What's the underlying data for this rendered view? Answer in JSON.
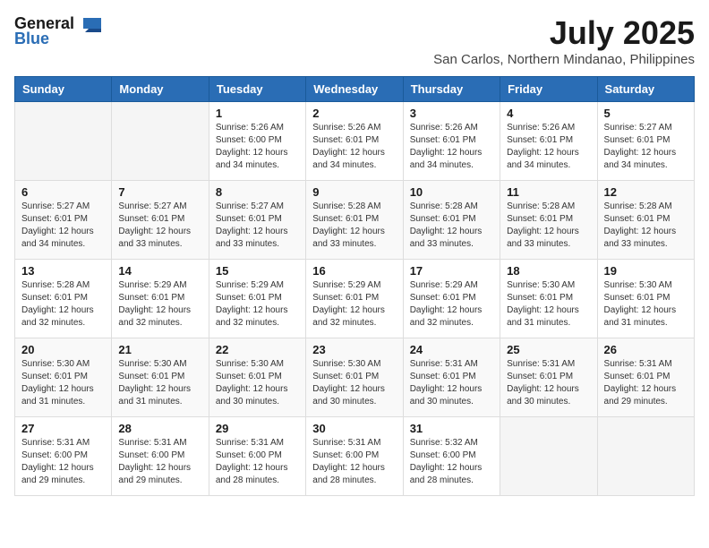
{
  "logo": {
    "general": "General",
    "blue": "Blue"
  },
  "title": {
    "month": "July 2025",
    "location": "San Carlos, Northern Mindanao, Philippines"
  },
  "weekdays": [
    "Sunday",
    "Monday",
    "Tuesday",
    "Wednesday",
    "Thursday",
    "Friday",
    "Saturday"
  ],
  "weeks": [
    [
      {
        "day": "",
        "info": ""
      },
      {
        "day": "",
        "info": ""
      },
      {
        "day": "1",
        "info": "Sunrise: 5:26 AM\nSunset: 6:00 PM\nDaylight: 12 hours and 34 minutes."
      },
      {
        "day": "2",
        "info": "Sunrise: 5:26 AM\nSunset: 6:01 PM\nDaylight: 12 hours and 34 minutes."
      },
      {
        "day": "3",
        "info": "Sunrise: 5:26 AM\nSunset: 6:01 PM\nDaylight: 12 hours and 34 minutes."
      },
      {
        "day": "4",
        "info": "Sunrise: 5:26 AM\nSunset: 6:01 PM\nDaylight: 12 hours and 34 minutes."
      },
      {
        "day": "5",
        "info": "Sunrise: 5:27 AM\nSunset: 6:01 PM\nDaylight: 12 hours and 34 minutes."
      }
    ],
    [
      {
        "day": "6",
        "info": "Sunrise: 5:27 AM\nSunset: 6:01 PM\nDaylight: 12 hours and 34 minutes."
      },
      {
        "day": "7",
        "info": "Sunrise: 5:27 AM\nSunset: 6:01 PM\nDaylight: 12 hours and 33 minutes."
      },
      {
        "day": "8",
        "info": "Sunrise: 5:27 AM\nSunset: 6:01 PM\nDaylight: 12 hours and 33 minutes."
      },
      {
        "day": "9",
        "info": "Sunrise: 5:28 AM\nSunset: 6:01 PM\nDaylight: 12 hours and 33 minutes."
      },
      {
        "day": "10",
        "info": "Sunrise: 5:28 AM\nSunset: 6:01 PM\nDaylight: 12 hours and 33 minutes."
      },
      {
        "day": "11",
        "info": "Sunrise: 5:28 AM\nSunset: 6:01 PM\nDaylight: 12 hours and 33 minutes."
      },
      {
        "day": "12",
        "info": "Sunrise: 5:28 AM\nSunset: 6:01 PM\nDaylight: 12 hours and 33 minutes."
      }
    ],
    [
      {
        "day": "13",
        "info": "Sunrise: 5:28 AM\nSunset: 6:01 PM\nDaylight: 12 hours and 32 minutes."
      },
      {
        "day": "14",
        "info": "Sunrise: 5:29 AM\nSunset: 6:01 PM\nDaylight: 12 hours and 32 minutes."
      },
      {
        "day": "15",
        "info": "Sunrise: 5:29 AM\nSunset: 6:01 PM\nDaylight: 12 hours and 32 minutes."
      },
      {
        "day": "16",
        "info": "Sunrise: 5:29 AM\nSunset: 6:01 PM\nDaylight: 12 hours and 32 minutes."
      },
      {
        "day": "17",
        "info": "Sunrise: 5:29 AM\nSunset: 6:01 PM\nDaylight: 12 hours and 32 minutes."
      },
      {
        "day": "18",
        "info": "Sunrise: 5:30 AM\nSunset: 6:01 PM\nDaylight: 12 hours and 31 minutes."
      },
      {
        "day": "19",
        "info": "Sunrise: 5:30 AM\nSunset: 6:01 PM\nDaylight: 12 hours and 31 minutes."
      }
    ],
    [
      {
        "day": "20",
        "info": "Sunrise: 5:30 AM\nSunset: 6:01 PM\nDaylight: 12 hours and 31 minutes."
      },
      {
        "day": "21",
        "info": "Sunrise: 5:30 AM\nSunset: 6:01 PM\nDaylight: 12 hours and 31 minutes."
      },
      {
        "day": "22",
        "info": "Sunrise: 5:30 AM\nSunset: 6:01 PM\nDaylight: 12 hours and 30 minutes."
      },
      {
        "day": "23",
        "info": "Sunrise: 5:30 AM\nSunset: 6:01 PM\nDaylight: 12 hours and 30 minutes."
      },
      {
        "day": "24",
        "info": "Sunrise: 5:31 AM\nSunset: 6:01 PM\nDaylight: 12 hours and 30 minutes."
      },
      {
        "day": "25",
        "info": "Sunrise: 5:31 AM\nSunset: 6:01 PM\nDaylight: 12 hours and 30 minutes."
      },
      {
        "day": "26",
        "info": "Sunrise: 5:31 AM\nSunset: 6:01 PM\nDaylight: 12 hours and 29 minutes."
      }
    ],
    [
      {
        "day": "27",
        "info": "Sunrise: 5:31 AM\nSunset: 6:00 PM\nDaylight: 12 hours and 29 minutes."
      },
      {
        "day": "28",
        "info": "Sunrise: 5:31 AM\nSunset: 6:00 PM\nDaylight: 12 hours and 29 minutes."
      },
      {
        "day": "29",
        "info": "Sunrise: 5:31 AM\nSunset: 6:00 PM\nDaylight: 12 hours and 28 minutes."
      },
      {
        "day": "30",
        "info": "Sunrise: 5:31 AM\nSunset: 6:00 PM\nDaylight: 12 hours and 28 minutes."
      },
      {
        "day": "31",
        "info": "Sunrise: 5:32 AM\nSunset: 6:00 PM\nDaylight: 12 hours and 28 minutes."
      },
      {
        "day": "",
        "info": ""
      },
      {
        "day": "",
        "info": ""
      }
    ]
  ]
}
